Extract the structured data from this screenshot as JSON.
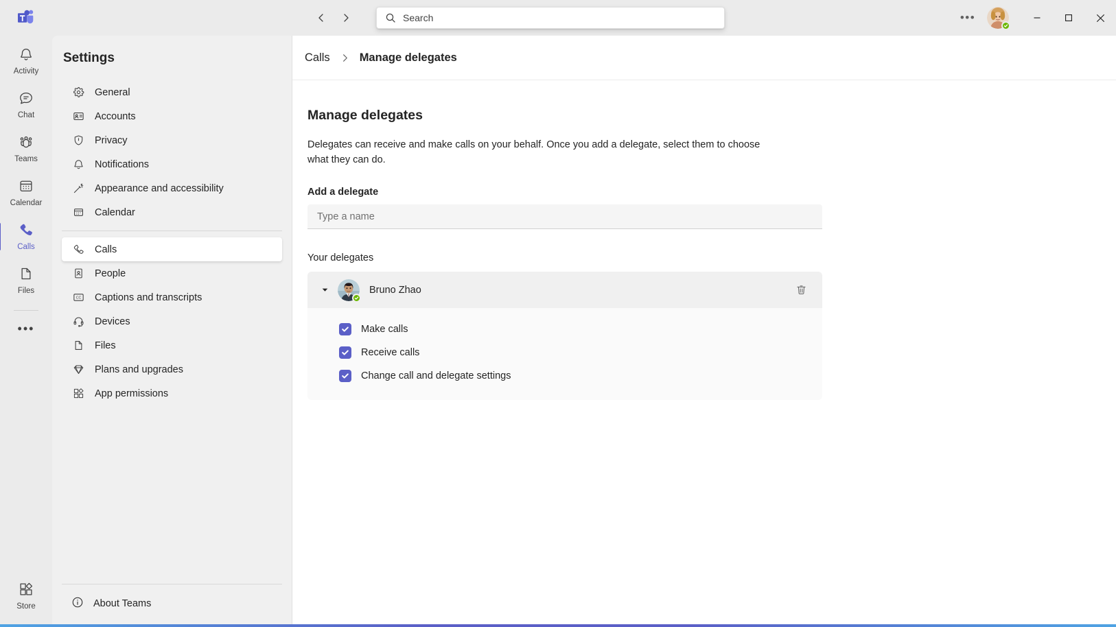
{
  "titlebar": {
    "logo_name": "microsoft-teams-logo",
    "back_label": "Back",
    "forward_label": "Forward",
    "search": {
      "placeholder": "Search",
      "value": "",
      "icon": "search-icon"
    },
    "more_label": "•••",
    "avatar": {
      "name": "avatar",
      "presence": "Available",
      "presence_color": "#6bb700"
    },
    "window_controls": {
      "minimize": "—",
      "maximize": "□",
      "close": "✕"
    }
  },
  "rail": {
    "items": [
      {
        "label": "Activity",
        "icon": "bell-icon",
        "active": false
      },
      {
        "label": "Chat",
        "icon": "chat-icon",
        "active": false
      },
      {
        "label": "Teams",
        "icon": "teams-icon",
        "active": false
      },
      {
        "label": "Calendar",
        "icon": "calendar-icon",
        "active": false
      },
      {
        "label": "Calls",
        "icon": "phone-icon",
        "active": true
      },
      {
        "label": "Files",
        "icon": "file-icon",
        "active": false
      }
    ],
    "more_label": "•••",
    "bottom": {
      "label": "Store",
      "icon": "store-icon"
    }
  },
  "settings": {
    "title": "Settings",
    "items_top": [
      {
        "label": "General",
        "icon": "gear-icon"
      },
      {
        "label": "Accounts",
        "icon": "id-card-icon"
      },
      {
        "label": "Privacy",
        "icon": "shield-icon"
      },
      {
        "label": "Notifications",
        "icon": "bell-icon"
      },
      {
        "label": "Appearance and accessibility",
        "icon": "magic-wand-icon"
      },
      {
        "label": "Calendar",
        "icon": "calendar-icon"
      }
    ],
    "items_bottom": [
      {
        "label": "Calls",
        "icon": "phone-icon",
        "active": true
      },
      {
        "label": "People",
        "icon": "contact-card-icon",
        "active": false
      },
      {
        "label": "Captions and transcripts",
        "icon": "closed-caption-icon",
        "active": false
      },
      {
        "label": "Devices",
        "icon": "headset-icon",
        "active": false
      },
      {
        "label": "Files",
        "icon": "file-icon",
        "active": false
      },
      {
        "label": "Plans and upgrades",
        "icon": "diamond-icon",
        "active": false
      },
      {
        "label": "App permissions",
        "icon": "apps-icon",
        "active": false
      }
    ],
    "about": {
      "label": "About Teams",
      "icon": "info-icon"
    }
  },
  "breadcrumb": {
    "parent": "Calls",
    "separator": "›",
    "current": "Manage delegates"
  },
  "main": {
    "page_title": "Manage delegates",
    "description": "Delegates can receive and make calls on your behalf. Once you add a delegate, select them to choose what they can do.",
    "add_section_label": "Add a delegate",
    "add_input": {
      "placeholder": "Type a name",
      "value": ""
    },
    "delegates_label": "Your delegates",
    "delegates": [
      {
        "name": "Bruno Zhao",
        "presence": "Available",
        "expanded": true,
        "delete_label": "Delete delegate",
        "permissions": [
          {
            "label": "Make calls",
            "checked": true
          },
          {
            "label": "Receive calls",
            "checked": true
          },
          {
            "label": "Change call and delegate settings",
            "checked": true
          }
        ]
      }
    ]
  },
  "colors": {
    "brand_purple": "#5b5fc7",
    "presence_green": "#6bb700",
    "rail_bg": "#ebebeb",
    "settings_bg": "#f0f0f0",
    "content_bg": "#ffffff"
  }
}
